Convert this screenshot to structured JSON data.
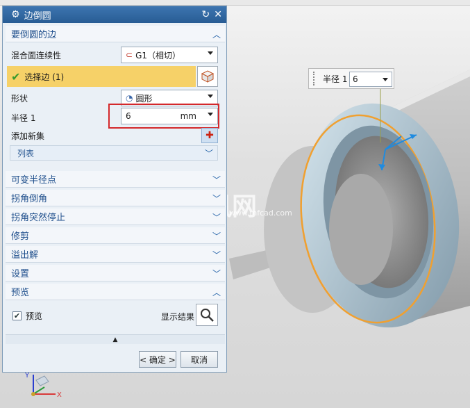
{
  "dialog": {
    "title": "边倒圆",
    "sections": {
      "edges_to_blend": "要倒圆的边",
      "variable_radius_points": "可变半径点",
      "corner_setback": "拐角倒角",
      "corner_stop": "拐角突然停止",
      "trim": "修剪",
      "overflow": "溢出解",
      "settings": "设置",
      "preview": "预览"
    },
    "blend_continuity": {
      "label": "混合面连续性",
      "value": "G1（相切）"
    },
    "select_edge": {
      "label": "选择边 (1)"
    },
    "shape": {
      "label": "形状",
      "value": "圆形"
    },
    "radius": {
      "label": "半径 1",
      "value": "6",
      "unit": "mm"
    },
    "add_new_set": {
      "label": "添加新集"
    },
    "list": {
      "label": "列表"
    },
    "preview_checkbox": {
      "label": "预览",
      "checked": true
    },
    "show_result": {
      "label": "显示结果"
    },
    "ok_button": "< 确定 >",
    "cancel_button": "取消"
  },
  "viewport_popup": {
    "label": "半径 1",
    "value": "6"
  },
  "watermark": {
    "text": "沐风网",
    "url": "www.mfcad.com"
  },
  "triad": {
    "x": "X",
    "y": "Y"
  },
  "colors": {
    "edge_highlight": "#f0a030",
    "title_bar": "#285c94",
    "selection_bar": "#f6d168",
    "radius_box": "#d4282b"
  },
  "icons": [
    "settings-gear-icon",
    "reset-icon",
    "close-icon",
    "chevron-up-icon",
    "chevron-down-icon",
    "check-icon",
    "cube-icon",
    "add-set-icon",
    "magnifier-icon",
    "collapse-triangle-icon",
    "triad-icon"
  ]
}
